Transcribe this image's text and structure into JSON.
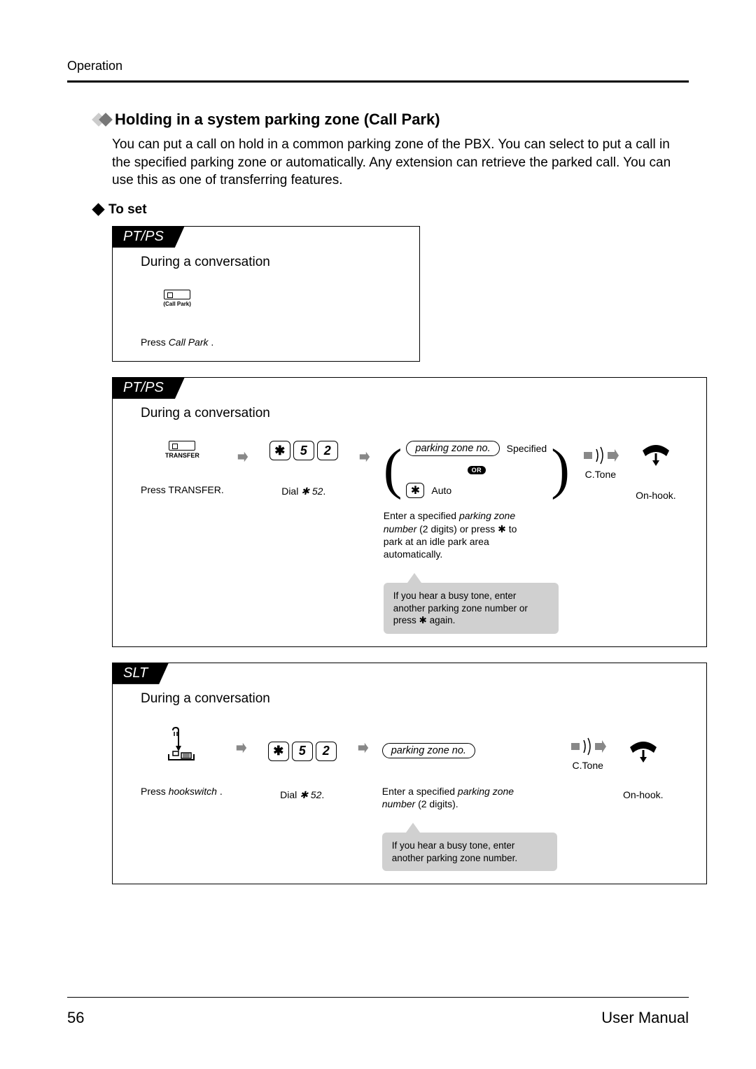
{
  "header": {
    "section": "Operation"
  },
  "heading": "Holding in a system parking zone (Call Park)",
  "intro": "You can put a call on hold in a common parking zone of the PBX. You can select to put a call in the specified parking zone or automatically. Any extension can retrieve the parked call. You can use this as one of transferring features.",
  "subhead": "To set",
  "panels": {
    "p1": {
      "tab": "PT/PS",
      "during": "During a conversation",
      "key_label": "(Call Park)",
      "caption_prefix": "Press ",
      "caption_ital": "Call Park",
      "caption_suffix": " ."
    },
    "p2": {
      "tab": "PT/PS",
      "during": "During a conversation",
      "transfer_label": "TRANSFER",
      "press_transfer": "Press TRANSFER.",
      "dial_star": "✱",
      "dial_5": "5",
      "dial_2": "2",
      "dial_caption_prefix": "Dial ",
      "dial_caption_ital": "✱ 52",
      "dial_caption_suffix": ".",
      "pill_parking": "parking zone no.",
      "specified": "Specified",
      "or": "OR",
      "auto": "Auto",
      "ctone": "C.Tone",
      "onhook": "On-hook.",
      "desc1a": "Enter a specified ",
      "desc1b": "parking zone number",
      "desc1c": "  (2 digits) or press ✱ to park at an idle park area automatically.",
      "bubble": "If you hear a busy tone, enter another parking zone number or press ✱ again."
    },
    "p3": {
      "tab": "SLT",
      "during": "During a conversation",
      "press_hook_prefix": "Press ",
      "press_hook_ital": "hookswitch",
      "press_hook_suffix": "  .",
      "dial_caption_prefix": "Dial ",
      "dial_caption_ital": "✱ 52",
      "dial_caption_suffix": ".",
      "pill_parking": "parking zone no.",
      "ctone": "C.Tone",
      "onhook": "On-hook.",
      "desc1a": "Enter a specified ",
      "desc1b": "parking zone number",
      "desc1c": "  (2 digits).",
      "bubble": "If you hear a busy tone, enter another parking zone number."
    }
  },
  "footer": {
    "page": "56",
    "manual": "User Manual"
  }
}
